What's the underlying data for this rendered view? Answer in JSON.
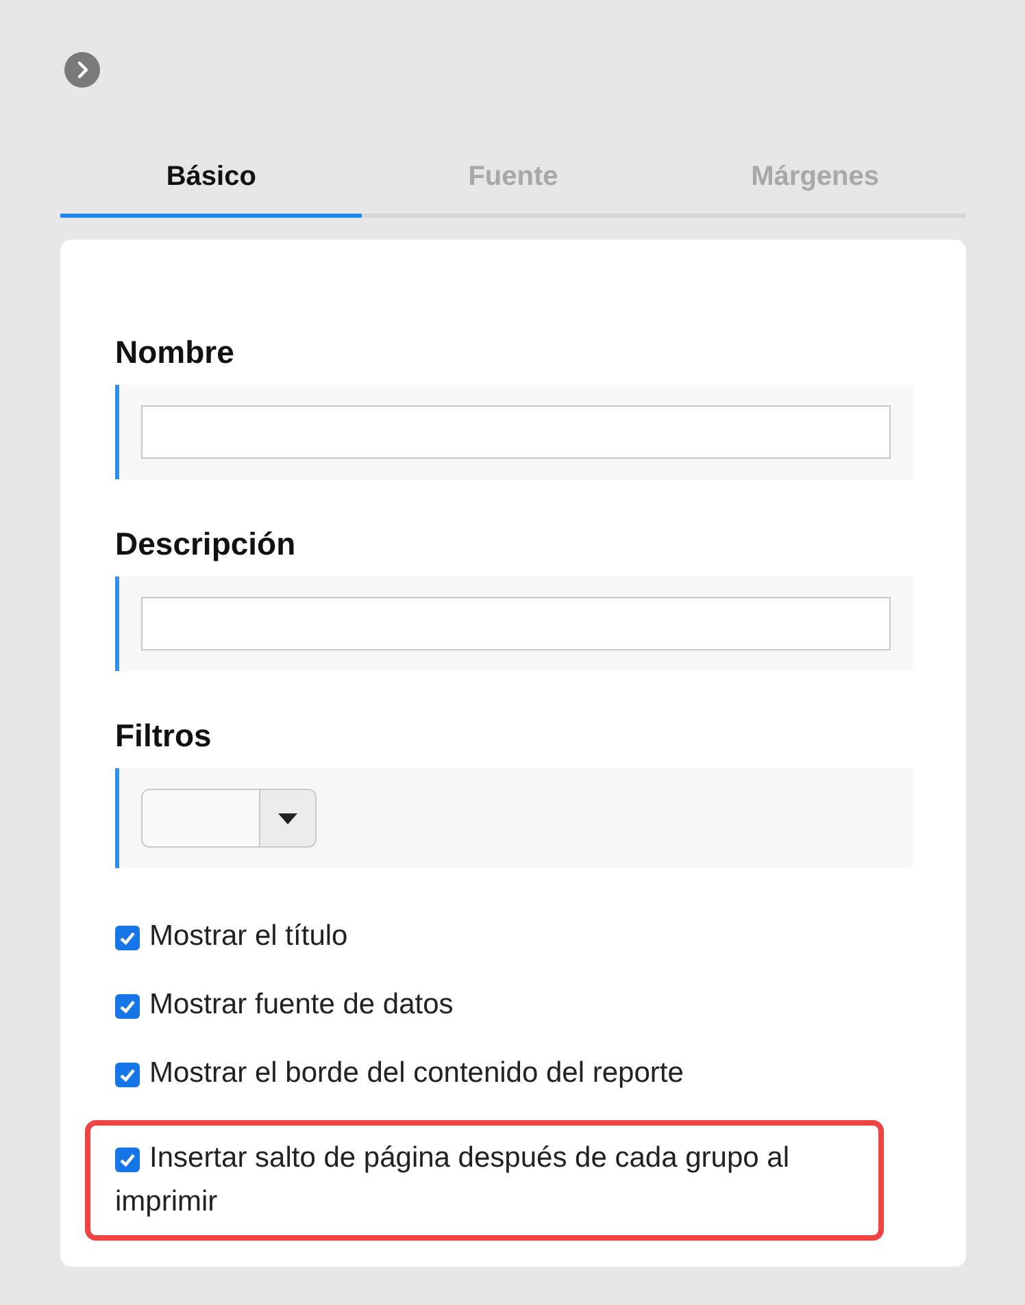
{
  "tabs": [
    {
      "label": "Básico",
      "selected": true
    },
    {
      "label": "Fuente",
      "selected": false
    },
    {
      "label": "Márgenes",
      "selected": false
    }
  ],
  "fields": [
    {
      "label": "Nombre",
      "kind": "text"
    },
    {
      "label": "Descripción",
      "kind": "text"
    },
    {
      "label": "Filtros",
      "kind": "select"
    }
  ],
  "options": [
    {
      "label": "Mostrar el título",
      "checked": true,
      "highlighted": false
    },
    {
      "label": "Mostrar fuente de datos",
      "checked": true,
      "highlighted": false
    },
    {
      "label": "Mostrar el borde del contenido del reporte",
      "checked": true,
      "highlighted": false
    },
    {
      "label": "Insertar salto de página después de cada grupo al imprimir",
      "checked": true,
      "highlighted": true
    }
  ]
}
